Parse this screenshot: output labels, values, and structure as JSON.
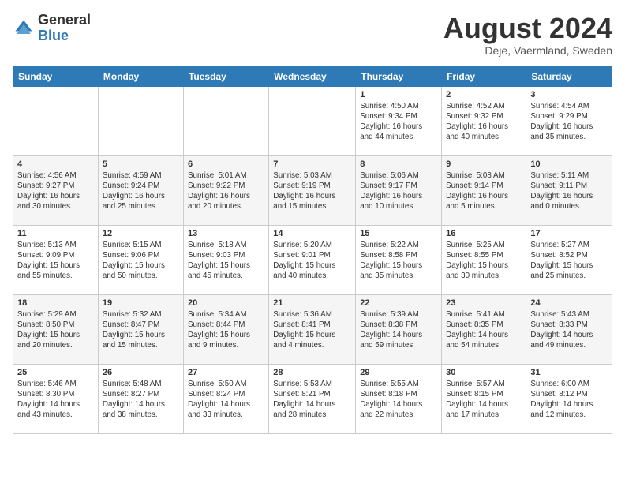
{
  "header": {
    "logo_line1": "General",
    "logo_line2": "Blue",
    "month_title": "August 2024",
    "location": "Deje, Vaermland, Sweden"
  },
  "days_of_week": [
    "Sunday",
    "Monday",
    "Tuesday",
    "Wednesday",
    "Thursday",
    "Friday",
    "Saturday"
  ],
  "weeks": [
    [
      {
        "day": "",
        "info": ""
      },
      {
        "day": "",
        "info": ""
      },
      {
        "day": "",
        "info": ""
      },
      {
        "day": "",
        "info": ""
      },
      {
        "day": "1",
        "info": "Sunrise: 4:50 AM\nSunset: 9:34 PM\nDaylight: 16 hours\nand 44 minutes."
      },
      {
        "day": "2",
        "info": "Sunrise: 4:52 AM\nSunset: 9:32 PM\nDaylight: 16 hours\nand 40 minutes."
      },
      {
        "day": "3",
        "info": "Sunrise: 4:54 AM\nSunset: 9:29 PM\nDaylight: 16 hours\nand 35 minutes."
      }
    ],
    [
      {
        "day": "4",
        "info": "Sunrise: 4:56 AM\nSunset: 9:27 PM\nDaylight: 16 hours\nand 30 minutes."
      },
      {
        "day": "5",
        "info": "Sunrise: 4:59 AM\nSunset: 9:24 PM\nDaylight: 16 hours\nand 25 minutes."
      },
      {
        "day": "6",
        "info": "Sunrise: 5:01 AM\nSunset: 9:22 PM\nDaylight: 16 hours\nand 20 minutes."
      },
      {
        "day": "7",
        "info": "Sunrise: 5:03 AM\nSunset: 9:19 PM\nDaylight: 16 hours\nand 15 minutes."
      },
      {
        "day": "8",
        "info": "Sunrise: 5:06 AM\nSunset: 9:17 PM\nDaylight: 16 hours\nand 10 minutes."
      },
      {
        "day": "9",
        "info": "Sunrise: 5:08 AM\nSunset: 9:14 PM\nDaylight: 16 hours\nand 5 minutes."
      },
      {
        "day": "10",
        "info": "Sunrise: 5:11 AM\nSunset: 9:11 PM\nDaylight: 16 hours\nand 0 minutes."
      }
    ],
    [
      {
        "day": "11",
        "info": "Sunrise: 5:13 AM\nSunset: 9:09 PM\nDaylight: 15 hours\nand 55 minutes."
      },
      {
        "day": "12",
        "info": "Sunrise: 5:15 AM\nSunset: 9:06 PM\nDaylight: 15 hours\nand 50 minutes."
      },
      {
        "day": "13",
        "info": "Sunrise: 5:18 AM\nSunset: 9:03 PM\nDaylight: 15 hours\nand 45 minutes."
      },
      {
        "day": "14",
        "info": "Sunrise: 5:20 AM\nSunset: 9:01 PM\nDaylight: 15 hours\nand 40 minutes."
      },
      {
        "day": "15",
        "info": "Sunrise: 5:22 AM\nSunset: 8:58 PM\nDaylight: 15 hours\nand 35 minutes."
      },
      {
        "day": "16",
        "info": "Sunrise: 5:25 AM\nSunset: 8:55 PM\nDaylight: 15 hours\nand 30 minutes."
      },
      {
        "day": "17",
        "info": "Sunrise: 5:27 AM\nSunset: 8:52 PM\nDaylight: 15 hours\nand 25 minutes."
      }
    ],
    [
      {
        "day": "18",
        "info": "Sunrise: 5:29 AM\nSunset: 8:50 PM\nDaylight: 15 hours\nand 20 minutes."
      },
      {
        "day": "19",
        "info": "Sunrise: 5:32 AM\nSunset: 8:47 PM\nDaylight: 15 hours\nand 15 minutes."
      },
      {
        "day": "20",
        "info": "Sunrise: 5:34 AM\nSunset: 8:44 PM\nDaylight: 15 hours\nand 9 minutes."
      },
      {
        "day": "21",
        "info": "Sunrise: 5:36 AM\nSunset: 8:41 PM\nDaylight: 15 hours\nand 4 minutes."
      },
      {
        "day": "22",
        "info": "Sunrise: 5:39 AM\nSunset: 8:38 PM\nDaylight: 14 hours\nand 59 minutes."
      },
      {
        "day": "23",
        "info": "Sunrise: 5:41 AM\nSunset: 8:35 PM\nDaylight: 14 hours\nand 54 minutes."
      },
      {
        "day": "24",
        "info": "Sunrise: 5:43 AM\nSunset: 8:33 PM\nDaylight: 14 hours\nand 49 minutes."
      }
    ],
    [
      {
        "day": "25",
        "info": "Sunrise: 5:46 AM\nSunset: 8:30 PM\nDaylight: 14 hours\nand 43 minutes."
      },
      {
        "day": "26",
        "info": "Sunrise: 5:48 AM\nSunset: 8:27 PM\nDaylight: 14 hours\nand 38 minutes."
      },
      {
        "day": "27",
        "info": "Sunrise: 5:50 AM\nSunset: 8:24 PM\nDaylight: 14 hours\nand 33 minutes."
      },
      {
        "day": "28",
        "info": "Sunrise: 5:53 AM\nSunset: 8:21 PM\nDaylight: 14 hours\nand 28 minutes."
      },
      {
        "day": "29",
        "info": "Sunrise: 5:55 AM\nSunset: 8:18 PM\nDaylight: 14 hours\nand 22 minutes."
      },
      {
        "day": "30",
        "info": "Sunrise: 5:57 AM\nSunset: 8:15 PM\nDaylight: 14 hours\nand 17 minutes."
      },
      {
        "day": "31",
        "info": "Sunrise: 6:00 AM\nSunset: 8:12 PM\nDaylight: 14 hours\nand 12 minutes."
      }
    ]
  ]
}
